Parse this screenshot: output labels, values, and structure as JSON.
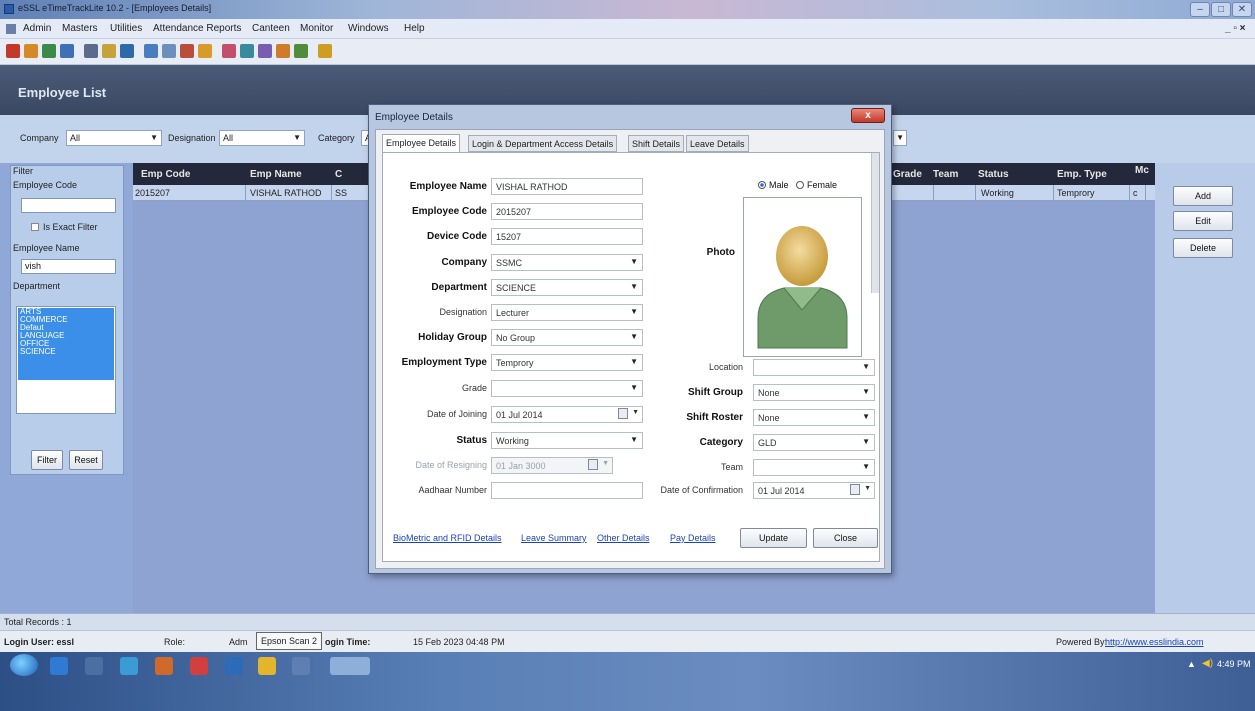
{
  "window": {
    "title": "eSSL eTimeTrackLite 10.2 - [Employees Details]"
  },
  "menu": [
    "Admin",
    "Masters",
    "Utilities",
    "Attendance Reports",
    "Canteen",
    "Monitor",
    "Windows",
    "Help"
  ],
  "header": {
    "title": "Employee List"
  },
  "filters": {
    "company_label": "Company",
    "company_value": "All",
    "designation_label": "Designation",
    "designation_value": "All",
    "category_label": "Category",
    "category_value": "Al"
  },
  "filter_panel": {
    "group": "Filter",
    "emp_code_label": "Employee Code",
    "emp_code_value": "",
    "exact_label": "Is Exact Filter",
    "emp_name_label": "Employee Name",
    "emp_name_value": "vish",
    "dept_label": "Department",
    "departments": [
      "ARTS",
      "COMMERCE",
      "Defaut",
      "LANGUAGE",
      "OFFICE",
      "SCIENCE"
    ],
    "filter_btn": "Filter",
    "reset_btn": "Reset"
  },
  "grid": {
    "headers": [
      "Emp Code",
      "Emp Name",
      "C",
      "Grade",
      "Team",
      "Status",
      "Emp. Type",
      "Mc"
    ],
    "row": {
      "code": "2015207",
      "name": "VISHAL RATHOD",
      "c": "SS",
      "status": "Working",
      "type": "Temprory",
      "m": "c"
    }
  },
  "right_buttons": {
    "add": "Add",
    "edit": "Edit",
    "delete": "Delete"
  },
  "dialog": {
    "title": "Employee Details",
    "close": "x",
    "tabs": [
      "Employee Details",
      "Login & Department Access Details",
      "Shift Details",
      "Leave Details"
    ],
    "fields": {
      "emp_name_label": "Employee Name",
      "emp_name": "VISHAL RATHOD",
      "emp_code_label": "Employee Code",
      "emp_code": "2015207",
      "device_code_label": "Device Code",
      "device_code": "15207",
      "company_label": "Company",
      "company": "SSMC",
      "department_label": "Department",
      "department": "SCIENCE",
      "designation_label": "Designation",
      "designation": "Lecturer",
      "holiday_label": "Holiday Group",
      "holiday": "No Group",
      "emptype_label": "Employment Type",
      "emptype": "Temprory",
      "grade_label": "Grade",
      "grade": "",
      "doj_label": "Date of Joining",
      "doj": "01 Jul 2014",
      "status_label": "Status",
      "status": "Working",
      "dor_label": "Date of Resigning",
      "dor": "01 Jan 3000",
      "aadhaar_label": "Aadhaar Number",
      "aadhaar": "",
      "male_label": "Male",
      "female_label": "Female",
      "photo_label": "Photo",
      "location_label": "Location",
      "location": "",
      "shift_group_label": "Shift Group",
      "shift_group": "None",
      "shift_roster_label": "Shift Roster",
      "shift_roster": "None",
      "category_label": "Category",
      "category": "GLD",
      "team_label": "Team",
      "team": "",
      "doc_label": "Date of Confirmation",
      "doc": "01 Jul 2014"
    },
    "links": [
      "BioMetric and RFID Details",
      "Leave Summary",
      "Other Details",
      "Pay Details"
    ],
    "update_btn": "Update",
    "close_btn": "Close"
  },
  "status": {
    "total_records": "Total Records : 1",
    "login_user": "Login User: essl",
    "role": "Role:",
    "role_value": "Adm",
    "tooltip": "Epson Scan 2",
    "login_time_label": "ogin Time:",
    "login_time": "15 Feb 2023 04:48 PM",
    "powered_by": "Powered By:",
    "powered_link": "http://www.esslindia.com"
  },
  "taskbar": {
    "clock": "4:49 PM"
  }
}
